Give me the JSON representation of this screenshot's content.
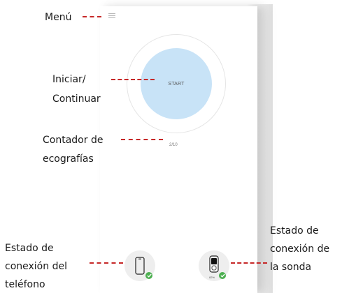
{
  "annotations": {
    "menu": "Menú",
    "start": [
      "Iniciar/",
      "Continuar"
    ],
    "counter": [
      "Contador de",
      "ecografías"
    ],
    "phone_status": [
      "Estado de",
      "conexión del",
      "teléfono"
    ],
    "probe_status": [
      "Estado de",
      "conexión de",
      "la sonda"
    ]
  },
  "app": {
    "start_label": "START",
    "scan_counter": "2/10",
    "probe_battery": "82%",
    "icons": {
      "menu": "hamburger-icon",
      "phone": "smartphone-icon",
      "probe": "ultrasound-probe-icon",
      "connected": "check-icon"
    }
  },
  "colors": {
    "accent_dash": "#c62828",
    "start_button": "#c8e3f7",
    "connected": "#4caf50"
  }
}
